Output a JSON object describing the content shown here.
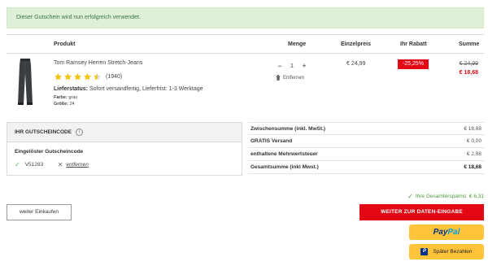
{
  "alert": {
    "message": "Dieser Gutschein wird nun erfolgreich verwendet."
  },
  "table_header": {
    "product": "Produkt",
    "quantity": "Menge",
    "unit_price": "Einzelpreis",
    "discount": "Ihr Rabatt",
    "total": "Summe"
  },
  "item": {
    "name": "Tom Ramsey Herren Stretch-Jeans",
    "rating": 4.5,
    "rating_max": 5,
    "rating_count": "(1940)",
    "delivery_label": "Lieferstatus:",
    "delivery_value": "Sofort versandfertig, Lieferfrist: 1-3 Werktage",
    "color_label": "Farbe:",
    "color_value": "grau",
    "size_label": "Größe:",
    "size_value": "24",
    "quantity": "1",
    "minus": "−",
    "plus": "+",
    "remove_label": "Entfernen",
    "unit_price": "€ 24,99",
    "discount": "-25,25%",
    "old_price": "€ 24,99",
    "new_price": "€ 18,68"
  },
  "coupon": {
    "title": "IHR GUTSCHEINCODE",
    "info_icon": "i",
    "redeemed_label": "Eingelöster Gutscheincode",
    "code": "V51283",
    "remove_label": "entfernen"
  },
  "totals": {
    "rows": [
      {
        "label": "Zwischensumme (inkl. MwSt.)",
        "value": "€ 18,68"
      },
      {
        "label": "GRATIS Versand",
        "value": "€ 0,00"
      },
      {
        "label": "enthaltene Mehrwertsteuer",
        "value": "€ 2,98"
      },
      {
        "label": "Gesamtsumme (inkl Mwst.)",
        "value": "€ 18,68"
      }
    ]
  },
  "savings": {
    "text": "Ihre Gesamtersparnis: € 6,31"
  },
  "buttons": {
    "continue": "weiter Einkaufen",
    "checkout": "WEITER ZUR DATEN-EINGABE",
    "paypal_pay": "Pay",
    "paypal_pal": "Pal",
    "pay_later": "Später Bezahlen",
    "pp_icon": "P"
  },
  "colors": {
    "accent_red": "#e30613",
    "success_green": "#4a9a3a",
    "alert_bg": "#dff0d8",
    "paypal_yellow": "#ffc439",
    "star_yellow": "#f2c200"
  }
}
